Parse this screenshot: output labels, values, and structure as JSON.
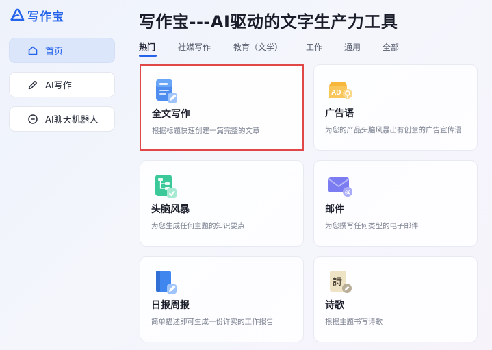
{
  "app": {
    "name": "写作宝"
  },
  "sidebar": {
    "items": [
      {
        "label": "首页",
        "icon": "home-icon",
        "active": true
      },
      {
        "label": "AI写作",
        "icon": "pencil-icon",
        "active": false
      },
      {
        "label": "AI聊天机器人",
        "icon": "chat-icon",
        "active": false
      }
    ]
  },
  "header": {
    "title": "写作宝---AI驱动的文字生产力工具"
  },
  "tabs": [
    {
      "label": "热门",
      "active": true
    },
    {
      "label": "社媒写作",
      "active": false
    },
    {
      "label": "教育（文学）",
      "active": false
    },
    {
      "label": "工作",
      "active": false
    },
    {
      "label": "通用",
      "active": false
    },
    {
      "label": "全部",
      "active": false
    }
  ],
  "cards": [
    {
      "title": "全文写作",
      "desc": "根据标题快速创建一篇完整的文章",
      "icon": "document-edit-icon",
      "selected": true
    },
    {
      "title": "广告语",
      "desc": "为您的产品头脑风暴出有创意的广告宣传语",
      "icon": "ad-tag-icon",
      "selected": false
    },
    {
      "title": "头脑风暴",
      "desc": "为您生成任何主题的知识要点",
      "icon": "mindmap-icon",
      "selected": false
    },
    {
      "title": "邮件",
      "desc": "为您撰写任何类型的电子邮件",
      "icon": "email-icon",
      "selected": false
    },
    {
      "title": "日报周报",
      "desc": "简单描述即可生成一份详实的工作报告",
      "icon": "report-book-icon",
      "selected": false
    },
    {
      "title": "诗歌",
      "desc": "根据主题书写诗歌",
      "icon": "poem-icon",
      "selected": false
    }
  ],
  "colors": {
    "accent": "#2563eb",
    "selection": "#e04848",
    "nav_active_bg": "#dce6fb"
  }
}
